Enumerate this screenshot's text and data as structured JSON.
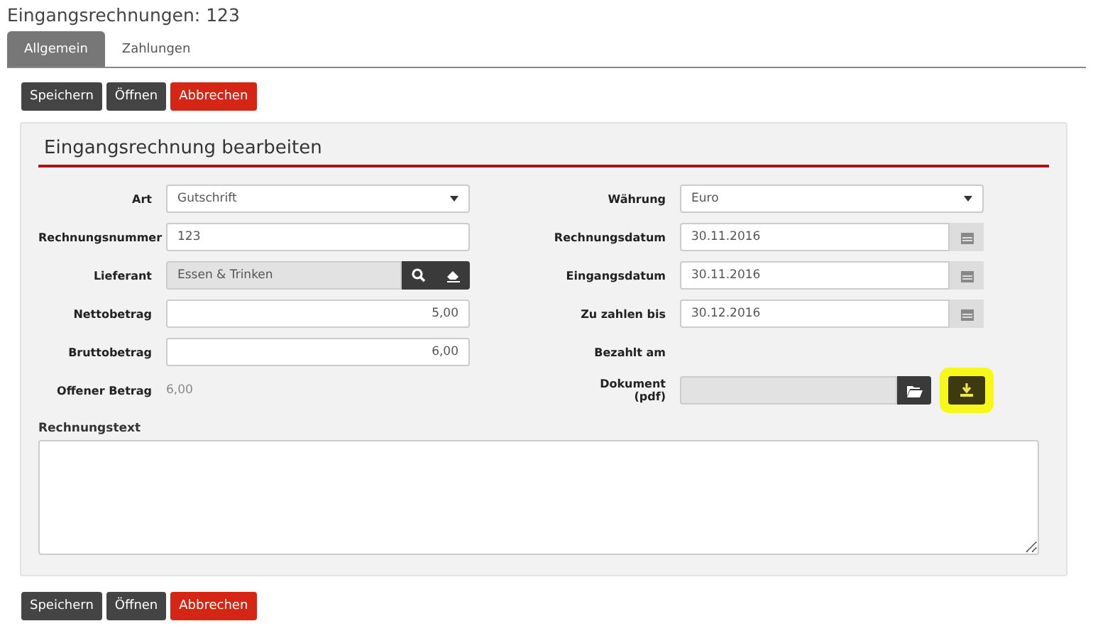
{
  "page_title": "Eingangsrechnungen: 123",
  "tabs": [
    {
      "label": "Allgemein",
      "selected": true
    },
    {
      "label": "Zahlungen",
      "selected": false
    }
  ],
  "top_buttons": [
    {
      "label": "Speichern",
      "kind": "dark"
    },
    {
      "label": "Öffnen",
      "kind": "dark"
    },
    {
      "label": "Abbrechen",
      "kind": "danger"
    }
  ],
  "panel": {
    "title": "Eingangsrechnung bearbeiten",
    "left_fields": [
      {
        "label": "Art",
        "kind": "select",
        "value": "Gutschrift"
      },
      {
        "label": "Rechnungsnummer",
        "kind": "text",
        "value": "123"
      },
      {
        "label": "Lieferant",
        "kind": "lookup",
        "value": "Essen & Trinken"
      },
      {
        "label": "Nettobetrag",
        "kind": "number",
        "value": "5,00"
      },
      {
        "label": "Bruttobetrag",
        "kind": "number",
        "value": "6,00"
      },
      {
        "label": "Offener Betrag",
        "kind": "static",
        "value": "6,00"
      }
    ],
    "right_fields": [
      {
        "label": "Währung",
        "kind": "select",
        "value": "Euro"
      },
      {
        "label": "Rechnungsdatum",
        "kind": "date",
        "value": "30.11.2016"
      },
      {
        "label": "Eingangsdatum",
        "kind": "date",
        "value": "30.11.2016"
      },
      {
        "label": "Zu zahlen bis",
        "kind": "date",
        "value": "30.12.2016"
      },
      {
        "label": "Bezahlt am",
        "kind": "empty"
      },
      {
        "label": "Dokument (pdf)",
        "kind": "file",
        "highlighted": true
      }
    ],
    "text_label": "Rechnungstext"
  },
  "bottom_buttons": [
    {
      "label": "Speichern",
      "kind": "dark"
    },
    {
      "label": "Öffnen",
      "kind": "dark"
    },
    {
      "label": "Abbrechen",
      "kind": "danger"
    }
  ]
}
